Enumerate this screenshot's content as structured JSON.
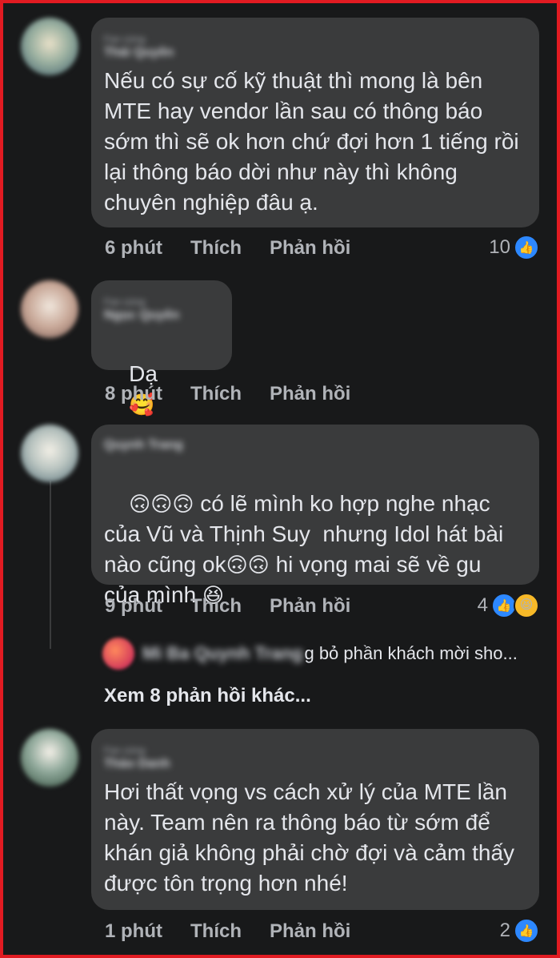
{
  "comments": [
    {
      "meta_label": "Fan cứng",
      "author": "Thái Quyên",
      "text": "Nếu có sự cố kỹ thuật thì mong là bên MTE hay vendor lần sau có thông báo sớm thì sẽ ok hơn chứ đợi hơn 1 tiếng rồi lại thông báo dời như này thì không chuyên nghiệp đâu ạ.",
      "time": "6 phút",
      "like_label": "Thích",
      "reply_label": "Phản hồi",
      "reaction_count": "10",
      "reactions": [
        "like"
      ]
    },
    {
      "meta_label": "Fan cứng",
      "author": "Ngọc Quyên",
      "text": "Dạ",
      "emoji": "🥰",
      "time": "8 phút",
      "like_label": "Thích",
      "reply_label": "Phản hồi"
    },
    {
      "author": "Quynh Trang",
      "emoji_prefix": "🙃🙃🙃",
      "text_part1": " có lẽ mình ko hợp nghe nhạc của Vũ và Thịnh Suy  nhưng Idol hát bài nào cũng ok",
      "emoji_mid": "🙃🙃",
      "text_part2": " hi vọng mai sẽ về gu của mình ",
      "emoji_end": "😆",
      "time": "9 phút",
      "like_label": "Thích",
      "reply_label": "Phản hồi",
      "reaction_count": "4",
      "reactions": [
        "like",
        "haha"
      ],
      "reply_preview": {
        "author": "Mi Ba Quynh Trang",
        "text": "g bỏ phần khách mời sho..."
      },
      "view_more": "Xem 8 phản hồi khác..."
    },
    {
      "meta_label": "Fan cứng",
      "author": "Thảo Danh",
      "text": "Hơi thất vọng vs cách xử lý của MTE lần này. Team nên ra thông báo từ sớm để khán giả không phải chờ đợi và cảm thấy được tôn trọng hơn nhé!",
      "time": "1 phút",
      "like_label": "Thích",
      "reply_label": "Phản hồi",
      "reaction_count": "2",
      "reactions": [
        "like"
      ]
    }
  ],
  "colors": {
    "background": "#18191a",
    "bubble": "#3a3b3c",
    "text": "#e4e6eb",
    "muted": "#b0b3b8",
    "like_blue": "#2d88ff",
    "frame_red": "#e11b22"
  },
  "icons": {
    "like": "thumbs-up-icon",
    "haha": "haha-icon"
  }
}
